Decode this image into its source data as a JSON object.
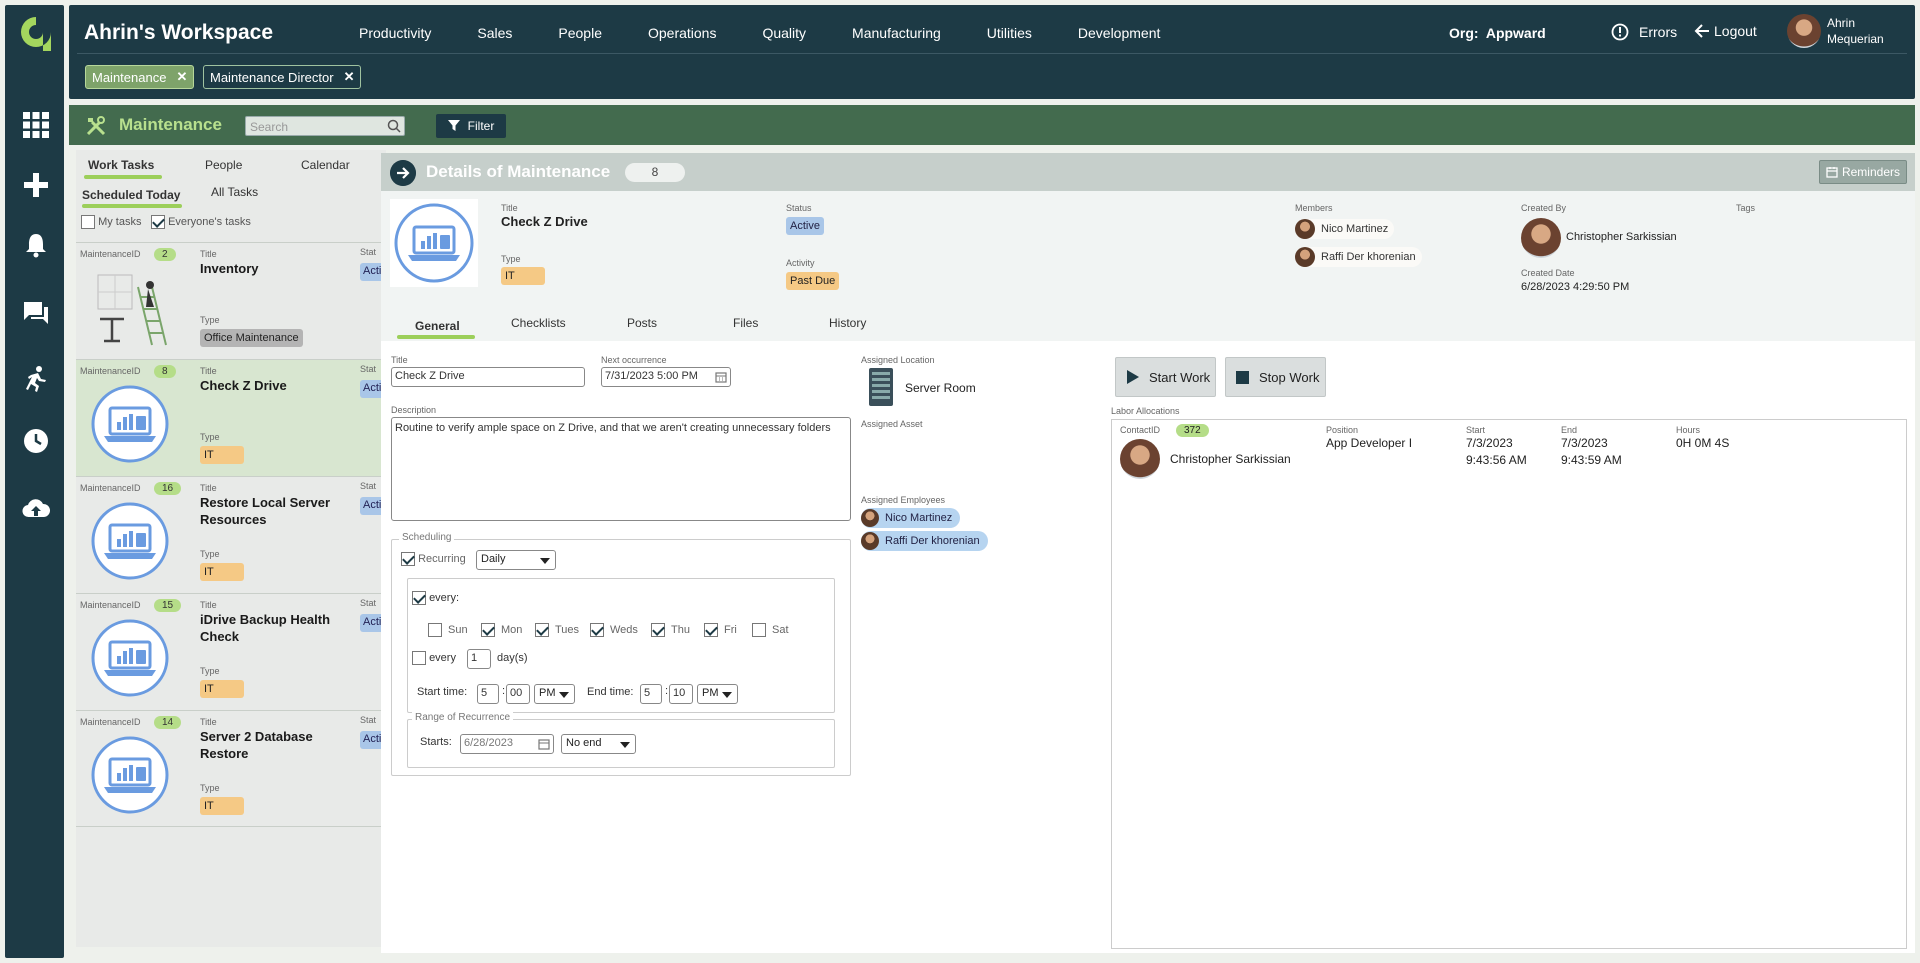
{
  "workspace": {
    "title": "Ahrin's Workspace"
  },
  "nav": [
    "Productivity",
    "Sales",
    "People",
    "Operations",
    "Quality",
    "Manufacturing",
    "Utilities",
    "Development"
  ],
  "org": {
    "label": "Org:",
    "name": "Appward"
  },
  "header": {
    "errors": "Errors",
    "logout": "Logout",
    "user_first": "Ahrin",
    "user_last": "Mequerian"
  },
  "chips": [
    {
      "label": "Maintenance"
    },
    {
      "label": "Maintenance Director"
    }
  ],
  "module": {
    "title": "Maintenance",
    "search_placeholder": "Search",
    "filter": "Filter"
  },
  "list": {
    "tabs": [
      "Work Tasks",
      "People",
      "Calendar"
    ],
    "subtabs": [
      "Scheduled Today",
      "All Tasks"
    ],
    "my_tasks": "My tasks",
    "everyones_tasks": "Everyone's tasks",
    "id_label": "MaintenanceID",
    "title_label": "Title",
    "type_label": "Type",
    "status_label": "Stat",
    "status_value": "Active",
    "items": [
      {
        "id": "2",
        "title": "Inventory",
        "type": "Office Maintenance"
      },
      {
        "id": "8",
        "title": "Check Z Drive",
        "type": "IT"
      },
      {
        "id": "16",
        "title": "Restore Local Server Resources",
        "type": "IT"
      },
      {
        "id": "15",
        "title": "iDrive Backup Health Check",
        "type": "IT"
      },
      {
        "id": "14",
        "title": "Server 2 Database Restore",
        "type": "IT"
      }
    ]
  },
  "detail": {
    "header_title": "Details of Maintenance",
    "count": "8",
    "reminders": "Reminders",
    "title_label": "Title",
    "title": "Check Z Drive",
    "type_label": "Type",
    "type": "IT",
    "status_label": "Status",
    "status": "Active",
    "activity_label": "Activity",
    "activity": "Past Due",
    "members_label": "Members",
    "members": [
      "Nico Martinez",
      "Raffi Der khorenian"
    ],
    "created_by_label": "Created By",
    "created_by": "Christopher Sarkissian",
    "created_date_label": "Created Date",
    "created_date": "6/28/2023 4:29:50 PM",
    "tags_label": "Tags",
    "tabs": [
      "General",
      "Checklists",
      "Posts",
      "Files",
      "History"
    ]
  },
  "general": {
    "title_label": "Title",
    "title_value": "Check Z Drive",
    "next_label": "Next occurrence",
    "next_value": "7/31/2023 5:00 PM",
    "desc_label": "Description",
    "desc_value": "Routine to verify ample space on Z Drive, and that we aren't creating unnecessary folders",
    "scheduling_label": "Scheduling",
    "recurring": "Recurring",
    "frequency": "Daily",
    "every_label": "every:",
    "days": [
      "Sun",
      "Mon",
      "Tues",
      "Weds",
      "Thu",
      "Fri",
      "Sat"
    ],
    "days_checked": [
      false,
      true,
      true,
      true,
      true,
      true,
      false
    ],
    "every2": "every",
    "every_n": "1",
    "days_unit": "day(s)",
    "start_time_label": "Start time:",
    "start_h": "5",
    "start_m": "00",
    "start_ampm": "PM",
    "end_time_label": "End time:",
    "end_h": "5",
    "end_m": "10",
    "end_ampm": "PM",
    "range_label": "Range of Recurrence",
    "starts_label": "Starts:",
    "starts_value": "6/28/2023",
    "end_option": "No end",
    "location_label": "Assigned Location",
    "location": "Server Room",
    "asset_label": "Assigned Asset",
    "employees_label": "Assigned Employees",
    "employees": [
      "Nico Martinez",
      "Raffi Der khorenian"
    ]
  },
  "labor": {
    "start_work": "Start Work",
    "stop_work": "Stop Work",
    "label": "Labor Allocations",
    "contact_label": "ContactID",
    "contact_id": "372",
    "name": "Christopher Sarkissian",
    "position_label": "Position",
    "position": "App Developer I",
    "start_label": "Start",
    "start_date": "7/3/2023",
    "start_time": "9:43:56 AM",
    "end_label": "End",
    "end_date": "7/3/2023",
    "end_time": "9:43:59 AM",
    "hours_label": "Hours",
    "hours": "0H 0M 4S"
  },
  "colors": {
    "navy": "#1d3a45",
    "green": "#436b4e",
    "accent": "#9ccf5a",
    "active_blue": "#a9c6e8",
    "tag_orange": "#f5c985"
  }
}
